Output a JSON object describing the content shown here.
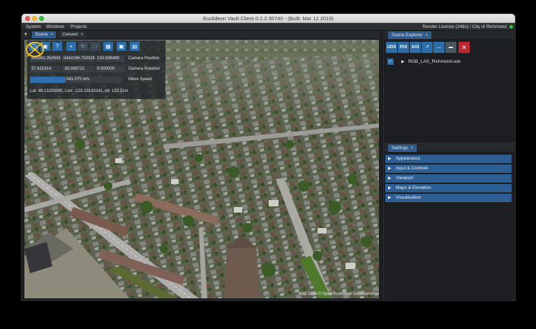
{
  "window": {
    "title": "Euclideon Vault Client 0.2.2.35740 - (Built: Mar 12 2019)"
  },
  "menubar": {
    "items": [
      "System",
      "Windows",
      "Projects"
    ],
    "license_text": "Render License (248s) / City of Richmond"
  },
  "scene_pane": {
    "menu_glyph": "▾",
    "tabs": [
      {
        "label": "Scene",
        "close": "×"
      },
      {
        "label": "Convert",
        "close": "×"
      }
    ]
  },
  "overlay": {
    "camera_position": {
      "x": "491951.052643",
      "y": "5442246.753326",
      "z": "133.506499",
      "label": "Camera Position"
    },
    "camera_rotation": {
      "x": "37.615314",
      "y": "-30.939721",
      "z": "0.000000",
      "label": "Camera Rotation"
    },
    "move_speed": {
      "value": "341.575 m/s",
      "label": "Move Speed",
      "level": 0.39
    },
    "latlon": "Lat: 49.13209090, Lon: -123.10120242, Alt: 133.51m"
  },
  "viewport": {
    "attribution": "Map Data © OpenStreetMap contributors"
  },
  "scene_explorer": {
    "tab_label": "Scene Explorer",
    "tab_close": "×",
    "toolbar": [
      "UDS",
      "POI",
      "AOI"
    ],
    "items": [
      {
        "label": "RGB_LAS_Richmond.uds",
        "checked": true
      }
    ]
  },
  "settings": {
    "tab_label": "Settings",
    "tab_close": "×",
    "sections": [
      "Appearance",
      "Input & Controls",
      "Viewport",
      "Maps & Elevation",
      "Visualisation"
    ]
  },
  "colors": {
    "accent_blue": "#2f5c8c",
    "status_green": "#2ecc40",
    "delete_red": "#c0262d"
  }
}
